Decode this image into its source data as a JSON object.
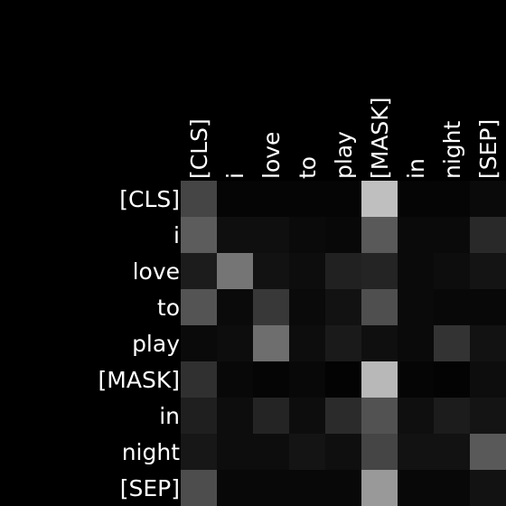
{
  "chart_data": {
    "type": "heatmap",
    "title": "",
    "xlabel": "",
    "ylabel": "",
    "x_labels": [
      "[CLS]",
      "i",
      "love",
      "to",
      "play",
      "[MASK]",
      "in",
      "night",
      "[SEP]"
    ],
    "y_labels": [
      "[CLS]",
      "i",
      "love",
      "to",
      "play",
      "[MASK]",
      "in",
      "night",
      "[SEP]"
    ],
    "value_range": [
      0,
      1
    ],
    "colormap": "grayscale (black = low, white = high)",
    "values": [
      [
        0.27,
        0.02,
        0.02,
        0.02,
        0.02,
        0.75,
        0.02,
        0.02,
        0.04
      ],
      [
        0.36,
        0.06,
        0.06,
        0.04,
        0.03,
        0.35,
        0.04,
        0.04,
        0.16
      ],
      [
        0.11,
        0.46,
        0.07,
        0.05,
        0.13,
        0.14,
        0.04,
        0.05,
        0.08
      ],
      [
        0.33,
        0.04,
        0.22,
        0.04,
        0.07,
        0.31,
        0.04,
        0.03,
        0.03
      ],
      [
        0.04,
        0.05,
        0.43,
        0.05,
        0.1,
        0.06,
        0.04,
        0.2,
        0.07
      ],
      [
        0.19,
        0.03,
        0.02,
        0.03,
        0.01,
        0.72,
        0.02,
        0.01,
        0.05
      ],
      [
        0.12,
        0.05,
        0.14,
        0.05,
        0.17,
        0.32,
        0.06,
        0.11,
        0.08
      ],
      [
        0.09,
        0.05,
        0.05,
        0.08,
        0.06,
        0.27,
        0.07,
        0.07,
        0.35
      ],
      [
        0.3,
        0.03,
        0.03,
        0.03,
        0.03,
        0.6,
        0.03,
        0.03,
        0.07
      ]
    ]
  }
}
